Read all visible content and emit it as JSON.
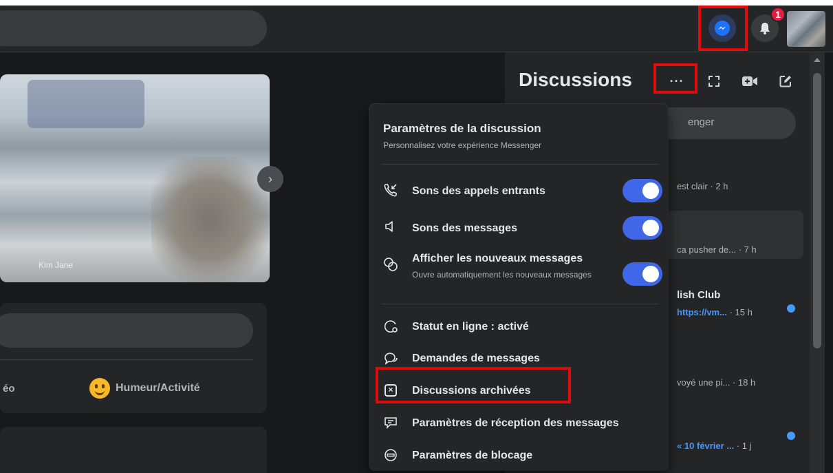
{
  "topbar": {
    "notification_count": "1",
    "icons": [
      "messenger-icon",
      "bell-icon"
    ]
  },
  "feed": {
    "story_name": "Kim Jane",
    "post_action_left": "éo",
    "post_action_mood": "Humeur/Activité"
  },
  "chats": {
    "title": "Discussions",
    "search_placeholder_visible": "enger",
    "rows": [
      {
        "preview": "est clair",
        "time": "· 2 h"
      },
      {
        "preview": "ca pusher de...",
        "time": "· 7 h"
      },
      {
        "name": "lish Club",
        "preview": "https://vm...",
        "time": "· 15 h"
      },
      {
        "preview": "voyé une pi...",
        "time": "· 18 h"
      },
      {
        "preview": "« 10 février ...",
        "time": "· 1 j"
      }
    ]
  },
  "menu": {
    "title": "Paramètres de la discussion",
    "subtitle": "Personnalisez votre expérience Messenger",
    "items": [
      {
        "label": "Sons des appels entrants",
        "icon": "phone-incoming-icon",
        "toggle_on": true
      },
      {
        "label": "Sons des messages",
        "icon": "speaker-icon",
        "toggle_on": true
      },
      {
        "label": "Afficher les nouveaux messages",
        "desc": "Ouvre automatiquement les nouveaux messages",
        "icon": "chat-bubbles-icon",
        "toggle_on": true
      },
      {
        "label": "Statut en ligne : activé",
        "icon": "online-status-icon"
      },
      {
        "label": "Demandes de messages",
        "icon": "message-requests-icon"
      },
      {
        "label": "Discussions archivées",
        "icon": "archive-box-icon"
      },
      {
        "label": "Paramètres de réception des messages",
        "icon": "message-delivery-icon"
      },
      {
        "label": "Paramètres de blocage",
        "icon": "block-icon"
      }
    ]
  },
  "colors": {
    "accent": "#3f67e8",
    "highlight": "#e00b0b",
    "panel": "#242526",
    "background": "#18191a"
  }
}
